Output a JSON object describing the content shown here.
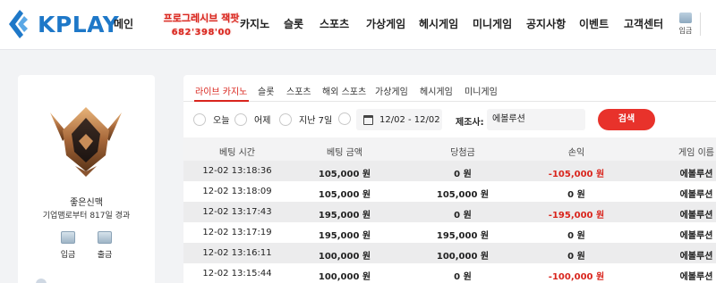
{
  "brand": {
    "name": "KPLAY",
    "accent": "#1e78c8",
    "red": "#d9251d"
  },
  "nav": {
    "items": [
      {
        "label": "메인",
        "name": "nav-main"
      },
      {
        "label": "카지노",
        "name": "nav-casino"
      },
      {
        "label": "슬롯",
        "name": "nav-slot"
      },
      {
        "label": "스포츠",
        "name": "nav-sports"
      },
      {
        "label": "가상게임",
        "name": "nav-virtual"
      },
      {
        "label": "헤시게임",
        "name": "nav-hash"
      },
      {
        "label": "미니게임",
        "name": "nav-mini"
      },
      {
        "label": "공지사항",
        "name": "nav-notice"
      },
      {
        "label": "이벤트",
        "name": "nav-event"
      },
      {
        "label": "고객센터",
        "name": "nav-support"
      }
    ],
    "promo_title": "프로그레시브 잭팟",
    "promo_value": "682'398'00",
    "deposit_icon_label": "입금"
  },
  "user": {
    "name": "좋은신맥",
    "sub": "기업맴로부터 817일 경과",
    "deposit_label": "입금",
    "withdraw_label": "출금"
  },
  "tabs": [
    {
      "label": "라이브 카지노",
      "active": true
    },
    {
      "label": "슬롯",
      "active": false
    },
    {
      "label": "스포츠",
      "active": false
    },
    {
      "label": "해외 스포츠",
      "active": false
    },
    {
      "label": "가상게임",
      "active": false
    },
    {
      "label": "헤시게임",
      "active": false
    },
    {
      "label": "미니게임",
      "active": false
    }
  ],
  "filters": {
    "radios": [
      "오늘",
      "어제",
      "지난 7일"
    ],
    "date_range": "12/02 - 12/02",
    "provider_label": "제조사:",
    "provider_value": "에볼루션",
    "search_label": "검색"
  },
  "table": {
    "columns": [
      "베팅 시간",
      "베팅 금액",
      "당첨금",
      "손익",
      "게임 이름"
    ],
    "rows": [
      {
        "time": "12-02 13:18:36",
        "bet": "105,000 원",
        "win": "0 원",
        "pnl": "-105,000 원",
        "game": "에볼루션",
        "neg": true
      },
      {
        "time": "12-02 13:18:09",
        "bet": "105,000 원",
        "win": "105,000 원",
        "pnl": "0 원",
        "game": "에볼루션",
        "neg": false
      },
      {
        "time": "12-02 13:17:43",
        "bet": "195,000 원",
        "win": "0 원",
        "pnl": "-195,000 원",
        "game": "에볼루션",
        "neg": true
      },
      {
        "time": "12-02 13:17:19",
        "bet": "195,000 원",
        "win": "195,000 원",
        "pnl": "0 원",
        "game": "에볼루션",
        "neg": false
      },
      {
        "time": "12-02 13:16:11",
        "bet": "100,000 원",
        "win": "100,000 원",
        "pnl": "0 원",
        "game": "에볼루션",
        "neg": false
      },
      {
        "time": "12-02 13:15:44",
        "bet": "100,000 원",
        "win": "0 원",
        "pnl": "-100,000 원",
        "game": "에볼루션",
        "neg": true
      }
    ]
  }
}
